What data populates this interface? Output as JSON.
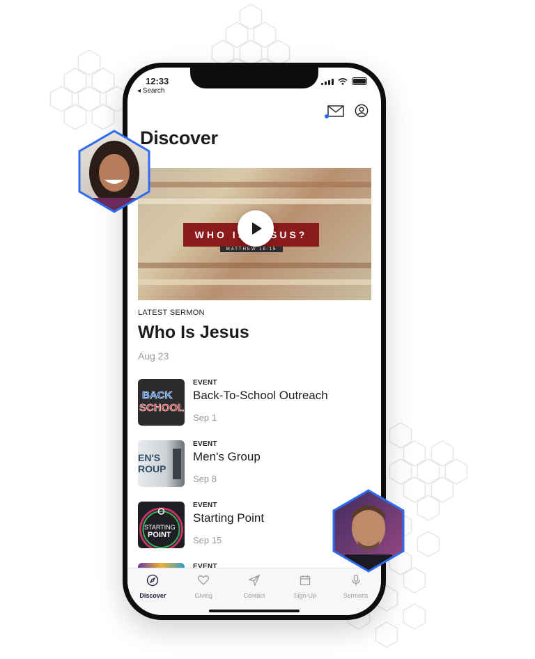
{
  "status_bar": {
    "time": "12:33",
    "back_label": "◂ Search"
  },
  "page": {
    "title": "Discover"
  },
  "latest_sermon": {
    "eyebrow": "LATEST SERMON",
    "title": "Who Is Jesus",
    "date": "Aug 23",
    "banner_text": "WHO IS JESUS?",
    "banner_subtitle": "MATTHEW 16:15"
  },
  "events": [
    {
      "tag": "EVENT",
      "title": "Back-To-School Outreach",
      "date": "Sep 1",
      "thumb_text": "BACK SCHOOL"
    },
    {
      "tag": "EVENT",
      "title": "Men's Group",
      "date": "Sep 8",
      "thumb_text": "EN'S ROUP"
    },
    {
      "tag": "EVENT",
      "title": "Starting Point",
      "date": "Sep 15",
      "thumb_text": "STARTING POINT"
    },
    {
      "tag": "EVENT"
    }
  ],
  "tabs": [
    {
      "label": "Discover",
      "icon": "compass-icon",
      "active": true
    },
    {
      "label": "Giving",
      "icon": "heart-icon"
    },
    {
      "label": "Contact",
      "icon": "paper-plane-icon"
    },
    {
      "label": "Sign-Up",
      "icon": "calendar-icon"
    },
    {
      "label": "Sermons",
      "icon": "microphone-icon"
    }
  ],
  "colors": {
    "accent": "#2d6cf0",
    "avatar_border": "#2d6cf0",
    "banner": "#8b1a1a"
  }
}
